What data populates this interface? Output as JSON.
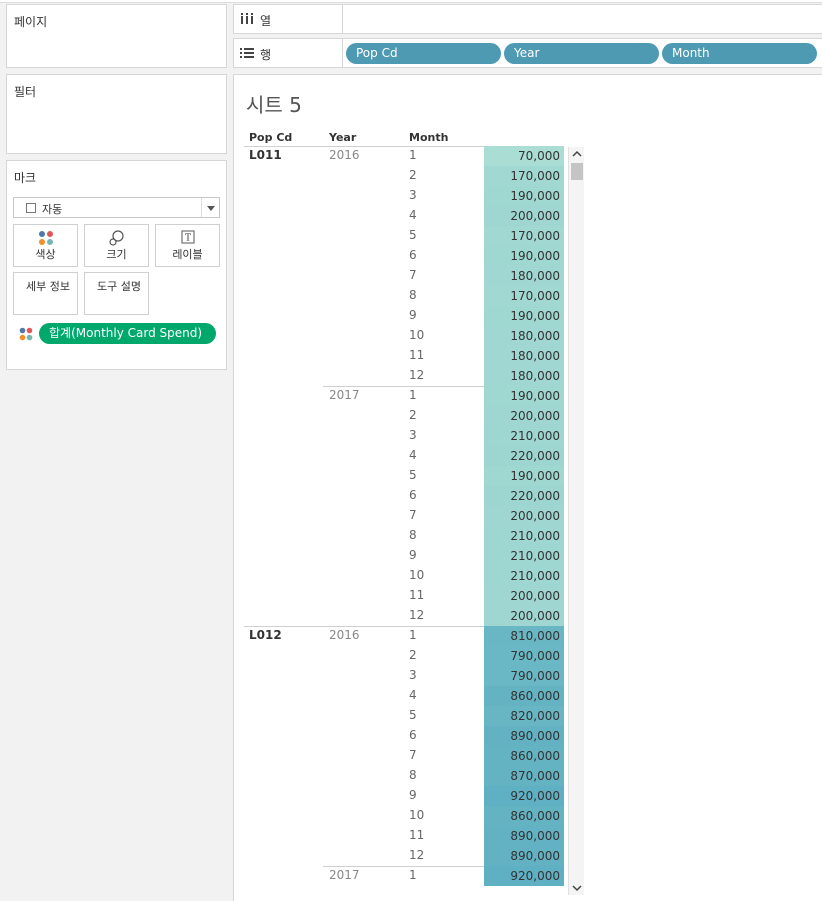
{
  "left_panel": {
    "pages_title": "페이지",
    "filters_title": "필터",
    "marks_title": "마크",
    "mark_type": "자동",
    "buttons": [
      {
        "name": "color-button",
        "label": "색상",
        "icon": "color-dots-icon"
      },
      {
        "name": "size-button",
        "label": "크기",
        "icon": "size-icon"
      },
      {
        "name": "label-button",
        "label": "레이블",
        "icon": "label-icon"
      },
      {
        "name": "detail-button",
        "label": "세부 정보",
        "icon": "detail-icon"
      },
      {
        "name": "tooltip-button",
        "label": "도구 설명",
        "icon": "tooltip-icon"
      }
    ],
    "measure_pill": "합계(Monthly Card Spend)"
  },
  "shelves": {
    "columns_label": "열",
    "rows_label": "행",
    "rows_pills": [
      "Pop Cd",
      "Year",
      "Month"
    ]
  },
  "sheet": {
    "title": "시트 5",
    "headers": {
      "pop_cd": "Pop Cd",
      "year": "Year",
      "month": "Month"
    },
    "groups": [
      {
        "pop_cd": "L011",
        "year": "2016",
        "months": [
          "1",
          "2",
          "3",
          "4",
          "5",
          "6",
          "7",
          "8",
          "9",
          "10",
          "11",
          "12"
        ],
        "values": [
          "70,000",
          "170,000",
          "190,000",
          "200,000",
          "170,000",
          "190,000",
          "180,000",
          "170,000",
          "190,000",
          "180,000",
          "180,000",
          "180,000"
        ]
      },
      {
        "pop_cd": "",
        "year": "2017",
        "months": [
          "1",
          "2",
          "3",
          "4",
          "5",
          "6",
          "7",
          "8",
          "9",
          "10",
          "11",
          "12"
        ],
        "values": [
          "190,000",
          "200,000",
          "210,000",
          "220,000",
          "190,000",
          "220,000",
          "200,000",
          "210,000",
          "210,000",
          "210,000",
          "200,000",
          "200,000"
        ]
      },
      {
        "pop_cd": "L012",
        "year": "2016",
        "months": [
          "1",
          "2",
          "3",
          "4",
          "5",
          "6",
          "7",
          "8",
          "9",
          "10",
          "11",
          "12"
        ],
        "values": [
          "810,000",
          "790,000",
          "790,000",
          "860,000",
          "820,000",
          "890,000",
          "860,000",
          "870,000",
          "920,000",
          "860,000",
          "890,000",
          "890,000"
        ]
      },
      {
        "pop_cd": "",
        "year": "2017",
        "months": [
          "1"
        ],
        "values": [
          "920,000"
        ]
      }
    ],
    "colors": {
      "low": "#aaddd4",
      "high": "#5fb0c2"
    }
  }
}
